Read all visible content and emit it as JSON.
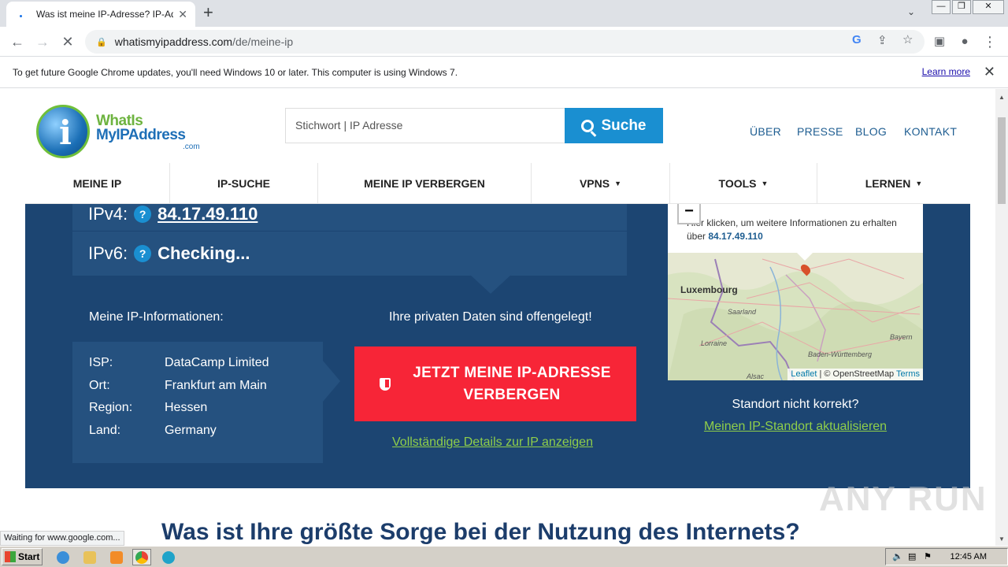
{
  "browser": {
    "tab_title": "Was ist meine IP-Adresse? IP-Adresse",
    "tab_close": "✕",
    "new_tab": "+",
    "url_host": "whatismyipaddress.com",
    "url_path": "/de/meine-ip",
    "win_min": "—",
    "win_max": "❐",
    "win_close": "✕",
    "infobar_text": "To get future Google Chrome updates, you'll need Windows 10 or later. This computer is using Windows 7.",
    "infobar_link": "Learn more",
    "status_text": "Waiting for www.google.com..."
  },
  "site": {
    "logo_line1": "WhatIs",
    "logo_line2": "MyIPAddress",
    "logo_line3": ".com",
    "search_placeholder": "Stichwort | IP Adresse",
    "search_button": "Suche",
    "topnav": [
      "ÜBER",
      "PRESSE",
      "BLOG",
      "KONTAKT"
    ],
    "mainnav": [
      {
        "label": "MEINE IP",
        "caret": ""
      },
      {
        "label": "IP-SUCHE",
        "caret": ""
      },
      {
        "label": "MEINE IP VERBERGEN",
        "caret": ""
      },
      {
        "label": "VPNS",
        "caret": "▼"
      },
      {
        "label": "TOOLS",
        "caret": "▼"
      },
      {
        "label": "LERNEN",
        "caret": "▼"
      }
    ]
  },
  "hero": {
    "ipv4_label": "IPv4:",
    "ipv4_value": "84.17.49.110",
    "ipv6_label": "IPv6:",
    "ipv6_value": "Checking...",
    "qmark": "?",
    "info_heading": "Meine IP-Informationen:",
    "privacy_heading": "Ihre privaten Daten sind offengelegt!",
    "info_rows": [
      {
        "key": "ISP:",
        "value": "DataCamp Limited"
      },
      {
        "key": "Ort:",
        "value": "Frankfurt am Main"
      },
      {
        "key": "Region:",
        "value": "Hessen"
      },
      {
        "key": "Land:",
        "value": "Germany"
      }
    ],
    "hide_button_line1": "JETZT MEINE IP-ADRESSE",
    "hide_button_line2": "VERBERGEN",
    "details_link": "Vollständige Details zur IP anzeigen",
    "not_correct": "Standort nicht korrekt?",
    "update_link": "Meinen IP-Standort aktualisieren"
  },
  "map": {
    "zoom_out": "−",
    "popup_line1": "Hier klicken, um weitere Informationen zu erhalten",
    "popup_line2_prefix": "über ",
    "popup_ip": "84.17.49.110",
    "cities": [
      "Luxembourg",
      "Saarland",
      "Lorraine",
      "Baden-Württemberg",
      "Bayern",
      "Alsac"
    ],
    "attrib_leaflet": "Leaflet",
    "attrib_sep": " | © OpenStreetMap ",
    "attrib_terms": "Terms"
  },
  "below": {
    "heading": "Was ist Ihre größte Sorge bei der Nutzung des Internets?"
  },
  "watermark": "ANY RUN",
  "taskbar": {
    "start": "Start",
    "clock": "12:45 AM"
  }
}
